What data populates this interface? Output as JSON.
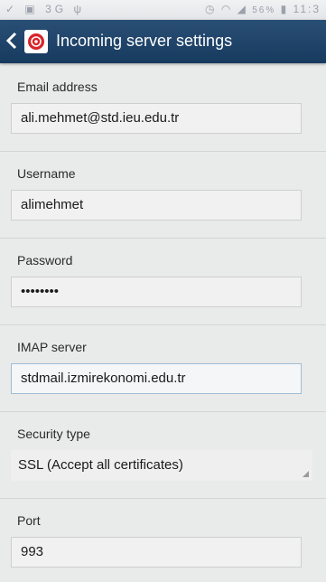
{
  "status_bar": {
    "signal_text": "3G",
    "battery_text": "56%",
    "time": "11:3"
  },
  "header": {
    "title": "Incoming server settings"
  },
  "fields": {
    "email": {
      "label": "Email address",
      "value": "ali.mehmet@std.ieu.edu.tr"
    },
    "username": {
      "label": "Username",
      "value": "alimehmet"
    },
    "password": {
      "label": "Password",
      "value": "••••••••"
    },
    "imap_server": {
      "label": "IMAP server",
      "value": "stdmail.izmirekonomi.edu.tr"
    },
    "security": {
      "label": "Security type",
      "value": "SSL (Accept all certificates)"
    },
    "port": {
      "label": "Port",
      "value": "993"
    }
  },
  "colors": {
    "action_bar": "#1f4468",
    "background": "#e9eaea",
    "app_icon_accent": "#d8232a"
  },
  "icons": {
    "back": "chevron-left-icon",
    "app": "email-app-icon",
    "select_indicator": "dropdown-corner-icon"
  }
}
